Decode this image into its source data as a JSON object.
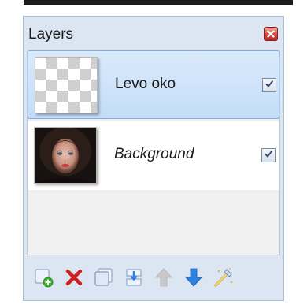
{
  "panel": {
    "title": "Layers",
    "close_icon": "close-icon"
  },
  "layers": [
    {
      "name": "Levo oko",
      "selected": true,
      "visible": true,
      "italic": false,
      "thumbnail": "transparent-checker"
    },
    {
      "name": "Background",
      "selected": false,
      "visible": true,
      "italic": true,
      "thumbnail": "portrait-photo"
    }
  ],
  "toolbar": {
    "buttons": [
      {
        "icon": "add-layer-icon"
      },
      {
        "icon": "delete-layer-icon"
      },
      {
        "icon": "duplicate-layer-icon"
      },
      {
        "icon": "merge-down-icon"
      },
      {
        "icon": "move-up-icon"
      },
      {
        "icon": "move-down-icon"
      },
      {
        "icon": "layer-properties-icon"
      }
    ]
  },
  "colors": {
    "panel_bg": "#dce6f3",
    "selected_row": "#c3dcf8",
    "delete_red": "#d01f1f",
    "arrow_blue": "#2d7fe0",
    "add_green": "#3fae2e"
  }
}
